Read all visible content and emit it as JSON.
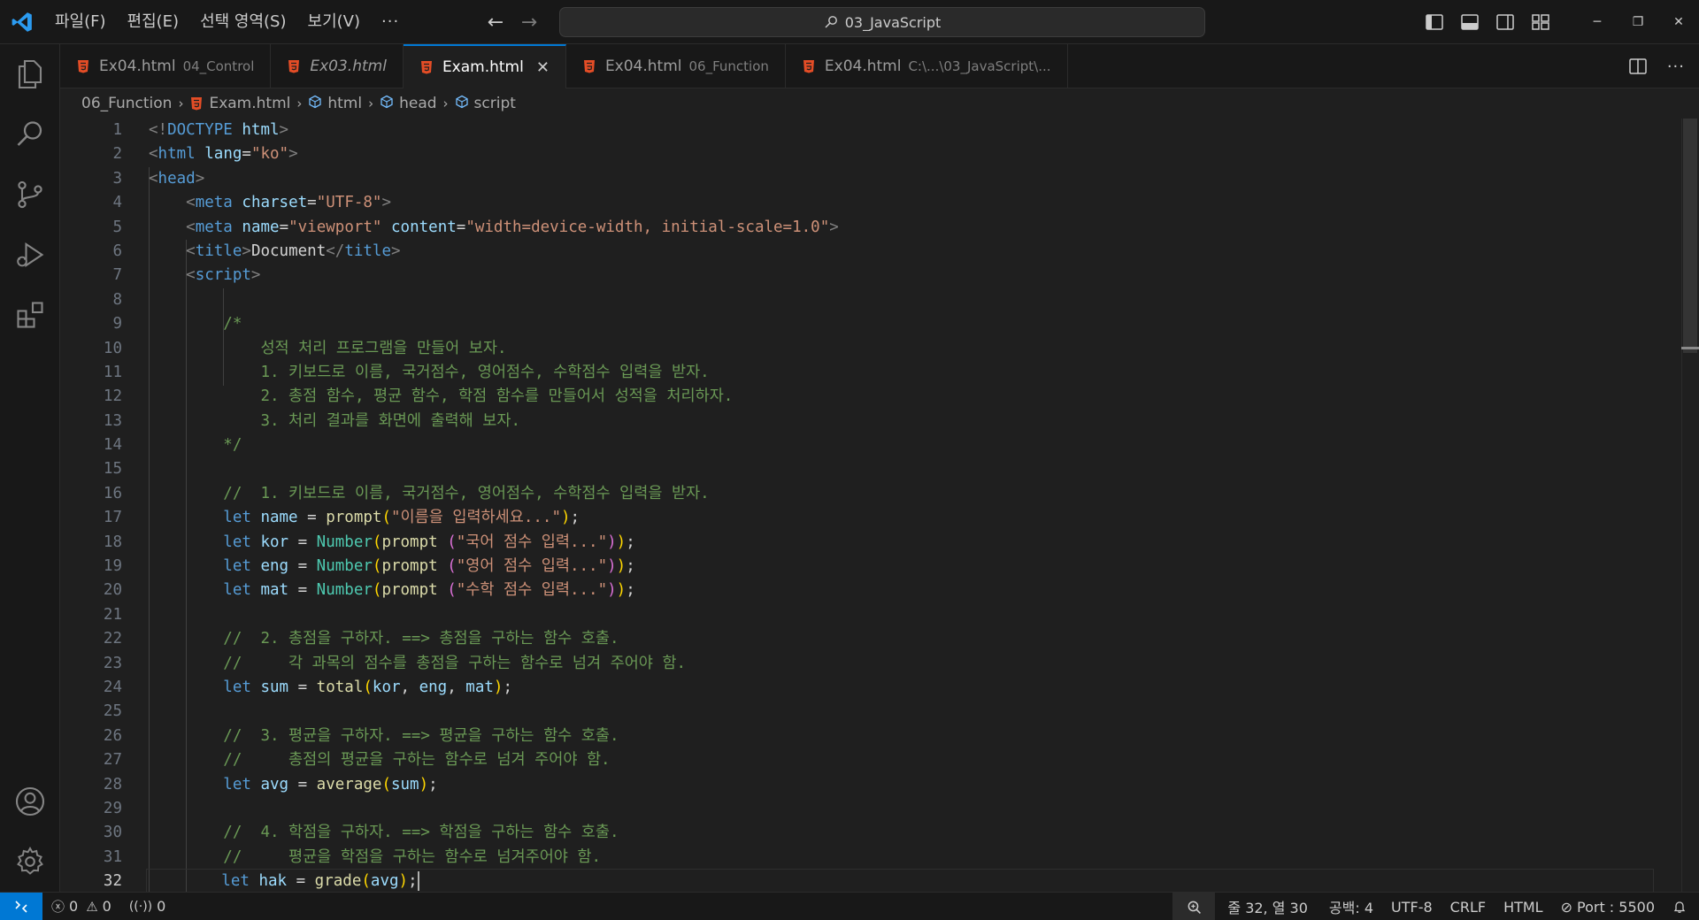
{
  "menu": {
    "items": [
      "파일(F)",
      "편집(E)",
      "선택 영역(S)",
      "보기(V)"
    ],
    "more": "···"
  },
  "search": {
    "label": "03_JavaScript"
  },
  "tabs": [
    {
      "file": "Ex04.html",
      "desc": "04_Control",
      "active": false,
      "italic": false
    },
    {
      "file": "Ex03.html",
      "desc": "",
      "active": false,
      "italic": true
    },
    {
      "file": "Exam.html",
      "desc": "",
      "active": true,
      "italic": false
    },
    {
      "file": "Ex04.html",
      "desc": "06_Function",
      "active": false,
      "italic": false
    },
    {
      "file": "Ex04.html",
      "desc": "C:\\...\\03_JavaScript\\...",
      "active": false,
      "italic": false
    }
  ],
  "breadcrumb": [
    "06_Function",
    "Exam.html",
    "html",
    "head",
    "script"
  ],
  "editor": {
    "current_line": 32,
    "line_numbers": [
      1,
      2,
      3,
      4,
      5,
      6,
      7,
      8,
      9,
      10,
      11,
      12,
      13,
      14,
      15,
      16,
      17,
      18,
      19,
      20,
      21,
      22,
      23,
      24,
      25,
      26,
      27,
      28,
      29,
      30,
      31,
      32
    ],
    "lines": [
      [
        [
          "t-punc",
          "<!"
        ],
        [
          "t-tag",
          "DOCTYPE"
        ],
        [
          "t-text",
          " "
        ],
        [
          "t-attr",
          "html"
        ],
        [
          "t-punc",
          ">"
        ]
      ],
      [
        [
          "t-punc",
          "<"
        ],
        [
          "t-tag",
          "html"
        ],
        [
          "t-text",
          " "
        ],
        [
          "t-attr",
          "lang"
        ],
        [
          "t-text",
          "="
        ],
        [
          "t-str",
          "\"ko\""
        ],
        [
          "t-punc",
          ">"
        ]
      ],
      [
        [
          "t-punc",
          "<"
        ],
        [
          "t-tag",
          "head"
        ],
        [
          "t-punc",
          ">"
        ]
      ],
      [
        [
          "t-text",
          "    "
        ],
        [
          "t-punc",
          "<"
        ],
        [
          "t-tag",
          "meta"
        ],
        [
          "t-text",
          " "
        ],
        [
          "t-attr",
          "charset"
        ],
        [
          "t-text",
          "="
        ],
        [
          "t-str",
          "\"UTF-8\""
        ],
        [
          "t-punc",
          ">"
        ]
      ],
      [
        [
          "t-text",
          "    "
        ],
        [
          "t-punc",
          "<"
        ],
        [
          "t-tag",
          "meta"
        ],
        [
          "t-text",
          " "
        ],
        [
          "t-attr",
          "name"
        ],
        [
          "t-text",
          "="
        ],
        [
          "t-str",
          "\"viewport\""
        ],
        [
          "t-text",
          " "
        ],
        [
          "t-attr",
          "content"
        ],
        [
          "t-text",
          "="
        ],
        [
          "t-str",
          "\"width=device-width, initial-scale=1.0\""
        ],
        [
          "t-punc",
          ">"
        ]
      ],
      [
        [
          "t-text",
          "    "
        ],
        [
          "t-punc",
          "<"
        ],
        [
          "t-tag",
          "title"
        ],
        [
          "t-punc",
          ">"
        ],
        [
          "t-text",
          "Document"
        ],
        [
          "t-punc",
          "</"
        ],
        [
          "t-tag",
          "title"
        ],
        [
          "t-punc",
          ">"
        ]
      ],
      [
        [
          "t-text",
          "    "
        ],
        [
          "t-punc",
          "<"
        ],
        [
          "t-tag",
          "script"
        ],
        [
          "t-punc",
          ">"
        ]
      ],
      [],
      [
        [
          "t-text",
          "        "
        ],
        [
          "t-com",
          "/*"
        ]
      ],
      [
        [
          "t-text",
          "            "
        ],
        [
          "t-com",
          "성적 처리 프로그램을 만들어 보자."
        ]
      ],
      [
        [
          "t-text",
          "            "
        ],
        [
          "t-com",
          "1. 키보드로 이름, 국거점수, 영어점수, 수학점수 입력을 받자."
        ]
      ],
      [
        [
          "t-text",
          "            "
        ],
        [
          "t-com",
          "2. 총점 함수, 평균 함수, 학점 함수를 만들어서 성적을 처리하자."
        ]
      ],
      [
        [
          "t-text",
          "            "
        ],
        [
          "t-com",
          "3. 처리 결과를 화면에 출력해 보자."
        ]
      ],
      [
        [
          "t-text",
          "        "
        ],
        [
          "t-com",
          "*/"
        ]
      ],
      [],
      [
        [
          "t-text",
          "        "
        ],
        [
          "t-com",
          "//  1. 키보드로 이름, 국거점수, 영어점수, 수학점수 입력을 받자."
        ]
      ],
      [
        [
          "t-text",
          "        "
        ],
        [
          "t-kw",
          "let"
        ],
        [
          "t-text",
          " "
        ],
        [
          "t-var",
          "name"
        ],
        [
          "t-text",
          " = "
        ],
        [
          "t-fn",
          "prompt"
        ],
        [
          "t-p1",
          "("
        ],
        [
          "t-str",
          "\"이름을 입력하세요...\""
        ],
        [
          "t-p1",
          ")"
        ],
        [
          "t-text",
          ";"
        ]
      ],
      [
        [
          "t-text",
          "        "
        ],
        [
          "t-kw",
          "let"
        ],
        [
          "t-text",
          " "
        ],
        [
          "t-var",
          "kor"
        ],
        [
          "t-text",
          " = "
        ],
        [
          "t-cls",
          "Number"
        ],
        [
          "t-p1",
          "("
        ],
        [
          "t-fn",
          "prompt"
        ],
        [
          "t-text",
          " "
        ],
        [
          "t-p2",
          "("
        ],
        [
          "t-str",
          "\"국어 점수 입력...\""
        ],
        [
          "t-p2",
          ")"
        ],
        [
          "t-p1",
          ")"
        ],
        [
          "t-text",
          ";"
        ]
      ],
      [
        [
          "t-text",
          "        "
        ],
        [
          "t-kw",
          "let"
        ],
        [
          "t-text",
          " "
        ],
        [
          "t-var",
          "eng"
        ],
        [
          "t-text",
          " = "
        ],
        [
          "t-cls",
          "Number"
        ],
        [
          "t-p1",
          "("
        ],
        [
          "t-fn",
          "prompt"
        ],
        [
          "t-text",
          " "
        ],
        [
          "t-p2",
          "("
        ],
        [
          "t-str",
          "\"영어 점수 입력...\""
        ],
        [
          "t-p2",
          ")"
        ],
        [
          "t-p1",
          ")"
        ],
        [
          "t-text",
          ";"
        ]
      ],
      [
        [
          "t-text",
          "        "
        ],
        [
          "t-kw",
          "let"
        ],
        [
          "t-text",
          " "
        ],
        [
          "t-var",
          "mat"
        ],
        [
          "t-text",
          " = "
        ],
        [
          "t-cls",
          "Number"
        ],
        [
          "t-p1",
          "("
        ],
        [
          "t-fn",
          "prompt"
        ],
        [
          "t-text",
          " "
        ],
        [
          "t-p2",
          "("
        ],
        [
          "t-str",
          "\"수학 점수 입력...\""
        ],
        [
          "t-p2",
          ")"
        ],
        [
          "t-p1",
          ")"
        ],
        [
          "t-text",
          ";"
        ]
      ],
      [],
      [
        [
          "t-text",
          "        "
        ],
        [
          "t-com",
          "//  2. 총점을 구하자. ==> 총점을 구하는 함수 호출."
        ]
      ],
      [
        [
          "t-text",
          "        "
        ],
        [
          "t-com",
          "//     각 과목의 점수를 총점을 구하는 함수로 넘겨 주어야 함."
        ]
      ],
      [
        [
          "t-text",
          "        "
        ],
        [
          "t-kw",
          "let"
        ],
        [
          "t-text",
          " "
        ],
        [
          "t-var",
          "sum"
        ],
        [
          "t-text",
          " = "
        ],
        [
          "t-fn",
          "total"
        ],
        [
          "t-p1",
          "("
        ],
        [
          "t-var",
          "kor"
        ],
        [
          "t-text",
          ", "
        ],
        [
          "t-var",
          "eng"
        ],
        [
          "t-text",
          ", "
        ],
        [
          "t-var",
          "mat"
        ],
        [
          "t-p1",
          ")"
        ],
        [
          "t-text",
          ";"
        ]
      ],
      [],
      [
        [
          "t-text",
          "        "
        ],
        [
          "t-com",
          "//  3. 평균을 구하자. ==> 평균을 구하는 함수 호출."
        ]
      ],
      [
        [
          "t-text",
          "        "
        ],
        [
          "t-com",
          "//     총점의 평균을 구하는 함수로 넘겨 주어야 함."
        ]
      ],
      [
        [
          "t-text",
          "        "
        ],
        [
          "t-kw",
          "let"
        ],
        [
          "t-text",
          " "
        ],
        [
          "t-var",
          "avg"
        ],
        [
          "t-text",
          " = "
        ],
        [
          "t-fn",
          "average"
        ],
        [
          "t-p1",
          "("
        ],
        [
          "t-var",
          "sum"
        ],
        [
          "t-p1",
          ")"
        ],
        [
          "t-text",
          ";"
        ]
      ],
      [],
      [
        [
          "t-text",
          "        "
        ],
        [
          "t-com",
          "//  4. 학점을 구하자. ==> 학점을 구하는 함수 호출."
        ]
      ],
      [
        [
          "t-text",
          "        "
        ],
        [
          "t-com",
          "//     평균을 학점을 구하는 함수로 넘겨주어야 함."
        ]
      ],
      [
        [
          "t-text",
          "        "
        ],
        [
          "t-kw",
          "let"
        ],
        [
          "t-text",
          " "
        ],
        [
          "t-var",
          "hak"
        ],
        [
          "t-text",
          " = "
        ],
        [
          "t-fn",
          "grade"
        ],
        [
          "t-p1",
          "("
        ],
        [
          "t-var",
          "avg"
        ],
        [
          "t-p1",
          ")"
        ],
        [
          "t-text",
          ";"
        ]
      ]
    ]
  },
  "status": {
    "errors": "0",
    "warnings": "0",
    "ports_forwarded": "0",
    "position": "줄 32, 열 30",
    "indent": "공백: 4",
    "encoding": "UTF-8",
    "eol": "CRLF",
    "language": "HTML",
    "live_server": "Port : 5500"
  },
  "colors": {
    "accent": "#0078d4",
    "html_icon": "#e44d26"
  }
}
